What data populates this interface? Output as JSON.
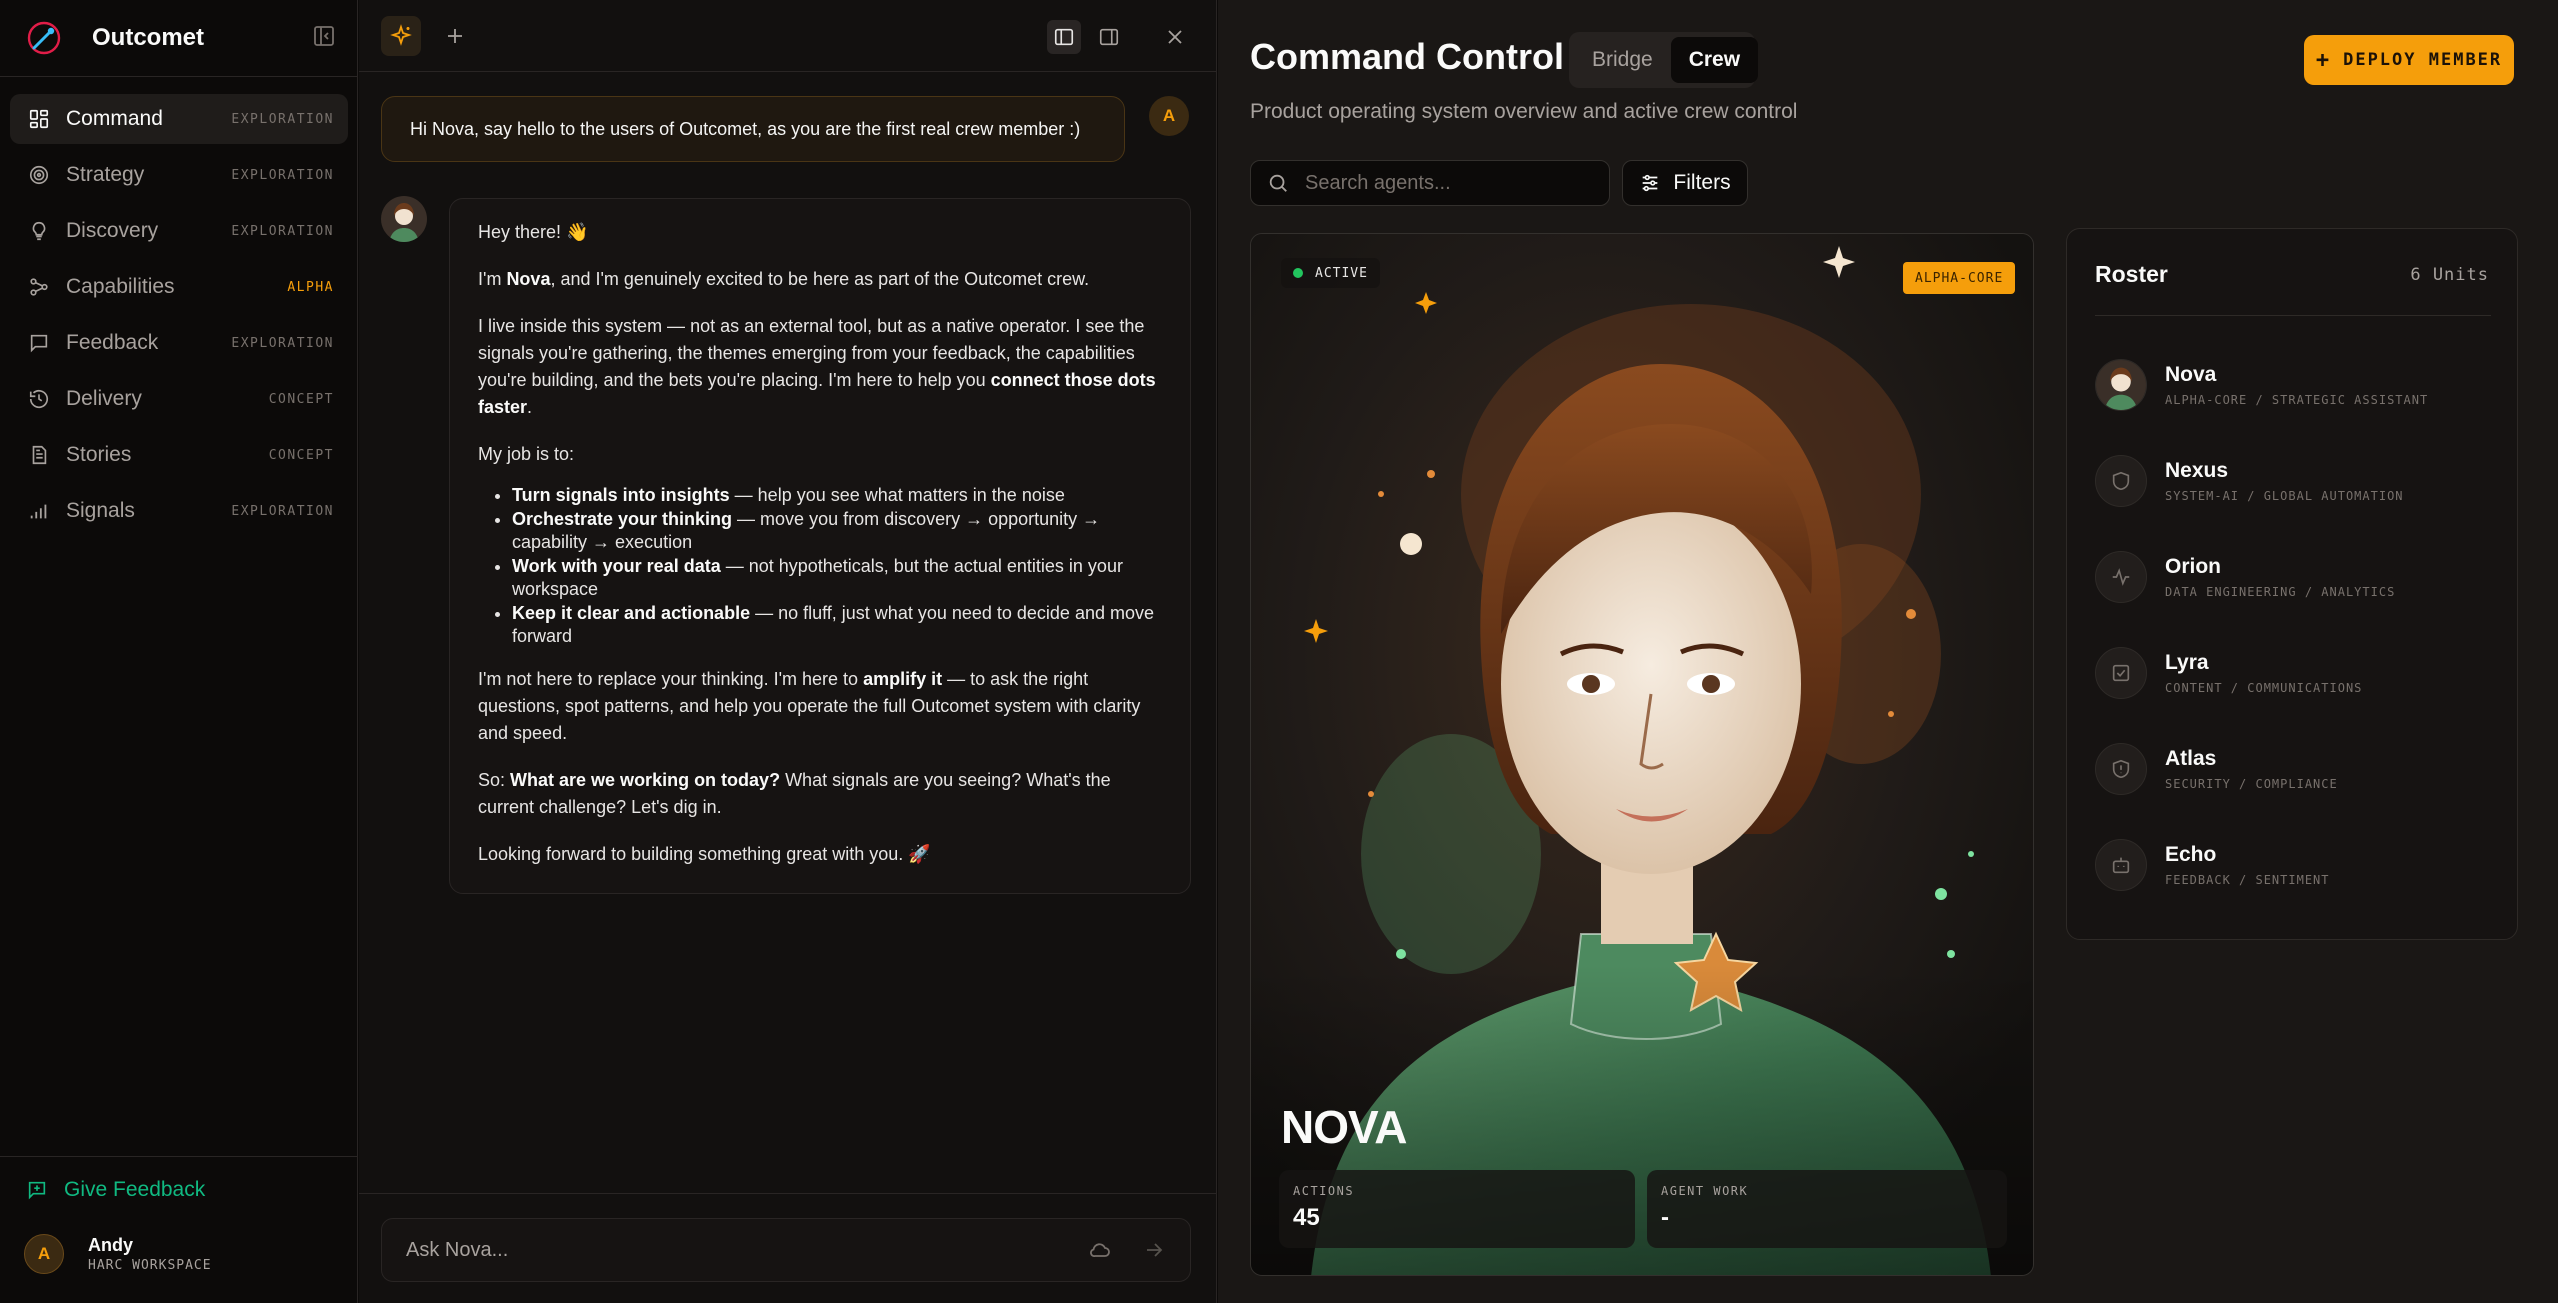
{
  "app": {
    "name": "Outcomet"
  },
  "sidebar": {
    "items": [
      {
        "label": "Command",
        "tag": "EXPLORATION",
        "icon": "grid-icon",
        "active": true
      },
      {
        "label": "Strategy",
        "tag": "EXPLORATION",
        "icon": "target-icon"
      },
      {
        "label": "Discovery",
        "tag": "EXPLORATION",
        "icon": "lightbulb-icon"
      },
      {
        "label": "Capabilities",
        "tag": "ALPHA",
        "icon": "network-icon"
      },
      {
        "label": "Feedback",
        "tag": "EXPLORATION",
        "icon": "message-icon"
      },
      {
        "label": "Delivery",
        "tag": "CONCEPT",
        "icon": "history-icon"
      },
      {
        "label": "Stories",
        "tag": "CONCEPT",
        "icon": "document-icon"
      },
      {
        "label": "Signals",
        "tag": "EXPLORATION",
        "icon": "signal-bars-icon"
      }
    ],
    "give_feedback": "Give Feedback",
    "user": {
      "initial": "A",
      "name": "Andy",
      "workspace": "HARC WORKSPACE"
    }
  },
  "chat": {
    "user_message": "Hi Nova, say hello to the users of Outcomet, as you are the first real crew member :)",
    "user_initial": "A",
    "reply": {
      "greeting": "Hey there! 👋",
      "p1_a": "I'm ",
      "p1_b": "Nova",
      "p1_c": ", and I'm genuinely excited to be here as part of the Outcomet crew.",
      "p2_a": "I live inside this system — not as an external tool, but as a native operator. I see the signals you're gathering, the themes emerging from your feedback, the capabilities you're building, and the bets you're placing. I'm here to help you ",
      "p2_b": "connect those dots faster",
      "p2_c": ".",
      "p3": "My job is to:",
      "bullets": [
        {
          "bold": "Turn signals into insights",
          "rest": " — help you see what matters in the noise"
        },
        {
          "bold": "Orchestrate your thinking",
          "rest": " — move you from discovery → opportunity → capability → execution"
        },
        {
          "bold": "Work with your real data",
          "rest": " — not hypotheticals, but the actual entities in your workspace"
        },
        {
          "bold": "Keep it clear and actionable",
          "rest": " — no fluff, just what you need to decide and move forward"
        }
      ],
      "p4_a": "I'm not here to replace your thinking. I'm here to ",
      "p4_b": "amplify it",
      "p4_c": " — to ask the right questions, spot patterns, and help you operate the full Outcomet system with clarity and speed.",
      "p5_a": "So: ",
      "p5_b": "What are we working on today?",
      "p5_c": " What signals are you seeing? What's the current challenge? Let's dig in.",
      "p6": "Looking forward to building something great with you. 🚀"
    },
    "input_placeholder": "Ask Nova..."
  },
  "main": {
    "title": "Command Control",
    "tabs": [
      {
        "label": "Bridge"
      },
      {
        "label": "Crew",
        "active": true
      }
    ],
    "subtitle": "Product operating system overview and active crew control",
    "deploy_label": "DEPLOY MEMBER",
    "search_placeholder": "Search agents...",
    "filters_label": "Filters",
    "hero": {
      "status": "ACTIVE",
      "badge": "ALPHA-CORE",
      "name": "NOVA",
      "stats": [
        {
          "label": "ACTIONS",
          "value": "45"
        },
        {
          "label": "AGENT WORK",
          "value": "-"
        }
      ]
    },
    "roster": {
      "title": "Roster",
      "count": "6 Units",
      "members": [
        {
          "name": "Nova",
          "role": "ALPHA-CORE / STRATEGIC ASSISTANT",
          "icon": "portrait-avatar"
        },
        {
          "name": "Nexus",
          "role": "SYSTEM-AI / GLOBAL AUTOMATION",
          "icon": "shield-icon"
        },
        {
          "name": "Orion",
          "role": "DATA ENGINEERING / ANALYTICS",
          "icon": "activity-icon"
        },
        {
          "name": "Lyra",
          "role": "CONTENT / COMMUNICATIONS",
          "icon": "check-square-icon"
        },
        {
          "name": "Atlas",
          "role": "SECURITY / COMPLIANCE",
          "icon": "shield-alert-icon"
        },
        {
          "name": "Echo",
          "role": "FEEDBACK / SENTIMENT",
          "icon": "bot-icon"
        }
      ]
    }
  },
  "colors": {
    "accent": "#f59e0b",
    "success": "#10b981",
    "active_dot": "#22c55e",
    "background": "#0c0a09"
  }
}
